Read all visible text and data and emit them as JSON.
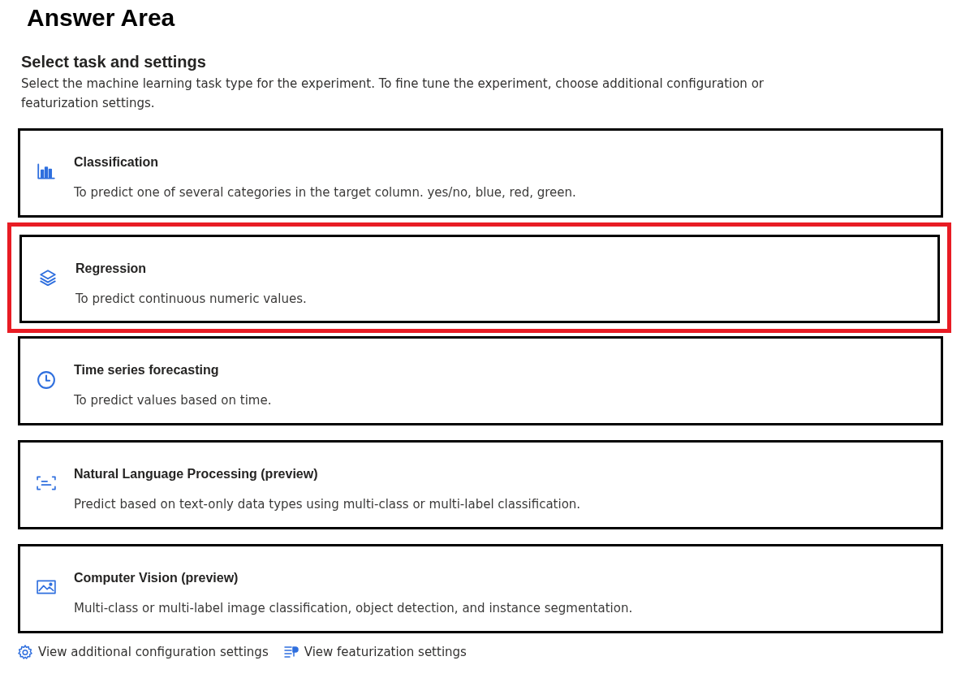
{
  "title": "Answer Area",
  "section": {
    "heading": "Select task and settings",
    "description": "Select the machine learning task type for the experiment. To fine tune the experiment, choose additional configuration or featurization settings."
  },
  "tasks": [
    {
      "kind": "classification",
      "title": "Classification",
      "description": "To predict one of several categories in the target column. yes/no, blue, red, green.",
      "selected": false
    },
    {
      "kind": "regression",
      "title": "Regression",
      "description": "To predict continuous numeric values.",
      "selected": true
    },
    {
      "kind": "forecasting",
      "title": "Time series forecasting",
      "description": "To predict values based on time.",
      "selected": false
    },
    {
      "kind": "nlp",
      "title": "Natural Language Processing (preview)",
      "description": "Predict based on text-only data types using multi-class or multi-label classification.",
      "selected": false
    },
    {
      "kind": "vision",
      "title": "Computer Vision (preview)",
      "description": "Multi-class or multi-label image classification, object detection, and instance segmentation.",
      "selected": false
    }
  ],
  "links": [
    {
      "kind": "settings",
      "label": "View additional configuration settings"
    },
    {
      "kind": "featurization",
      "label": "View featurization settings"
    }
  ]
}
